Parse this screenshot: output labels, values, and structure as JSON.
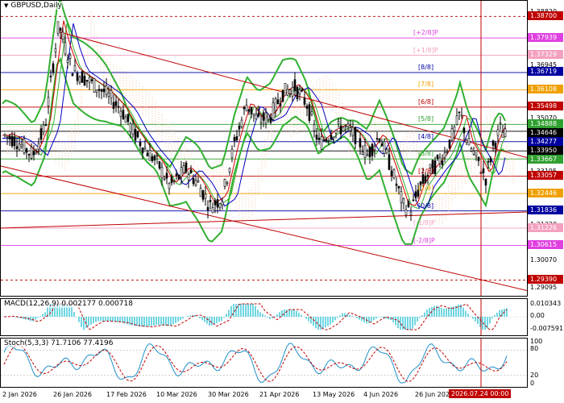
{
  "chart_title": "GBPUSD,Daily",
  "price_scale": {
    "ticks": [
      "1.38820",
      "1.36945",
      "1.35070",
      "1.33195",
      "1.31320",
      "1.30070",
      "1.29095"
    ],
    "tags": [
      {
        "value": "1.38700",
        "color": "#c00000"
      },
      {
        "value": "1.37939",
        "color": "#e040e0"
      },
      {
        "value": "1.37329",
        "color": "#f4a0c0"
      },
      {
        "value": "1.36719",
        "color": "#0000a0"
      },
      {
        "value": "1.36108",
        "color": "#f0a000"
      },
      {
        "value": "1.35498",
        "color": "#c00000"
      },
      {
        "value": "1.34888",
        "color": "#30a030"
      },
      {
        "value": "1.34646",
        "color": "#000000"
      },
      {
        "value": "1.34277",
        "color": "#0000a0"
      },
      {
        "value": "1.33950",
        "color": "#000000"
      },
      {
        "value": "1.33667",
        "color": "#30a030"
      },
      {
        "value": "1.33057",
        "color": "#c00000"
      },
      {
        "value": "1.32446",
        "color": "#f0a000"
      },
      {
        "value": "1.31836",
        "color": "#0000a0"
      },
      {
        "value": "1.31226",
        "color": "#f4a0c0"
      },
      {
        "value": "1.30615",
        "color": "#e040e0"
      },
      {
        "value": "1.29390",
        "color": "#c00000"
      }
    ]
  },
  "murrey_levels": [
    {
      "label": "[+2/8]P",
      "color": "#e040e0"
    },
    {
      "label": "[+1/8]P",
      "color": "#f4a0c0"
    },
    {
      "label": "[8/8]",
      "color": "#0000a0"
    },
    {
      "label": "[7/8]",
      "color": "#f0a000"
    },
    {
      "label": "[6/8]",
      "color": "#c00000"
    },
    {
      "label": "[5/8]",
      "color": "#30a030"
    },
    {
      "label": "[4/8]",
      "color": "#0000a0"
    },
    {
      "label": "[3/8]",
      "color": "#30a030"
    },
    {
      "label": "[2/8]",
      "color": "#c00000"
    },
    {
      "label": "[1/8]",
      "color": "#f0a000"
    },
    {
      "label": "[0/8]",
      "color": "#0000a0"
    },
    {
      "label": "[-1/8]P",
      "color": "#f4a0c0"
    },
    {
      "label": "[-2/8]P",
      "color": "#e040e0"
    }
  ],
  "macd": {
    "title": "MACD(12,26,9) 0.002177 0.000718",
    "ticks": [
      "0.010343",
      "0.00",
      "-0.007591"
    ]
  },
  "stoch": {
    "title": "Stoch(5,3,3) 71.7106 77.4196",
    "ticks": [
      "100",
      "80",
      "20",
      "0"
    ]
  },
  "x_axis": {
    "labels": [
      "2 Jan 2026",
      "26 Jan 2026",
      "17 Feb 2026",
      "10 Mar 2026",
      "30 Mar 2026",
      "21 Apr 2026",
      "13 May 2026",
      "4 Jun 2026",
      "26 Jun 2026"
    ],
    "cursor_label": "2026.07.24 00:00"
  },
  "colors": {
    "bollinger": "#30b030",
    "trendline": "#c00000",
    "support": "#c00000",
    "macd_hist": "#40c8d8",
    "signal": "#c00000",
    "stoch_main": "#2090c8",
    "stoch_signal": "#c00000"
  }
}
